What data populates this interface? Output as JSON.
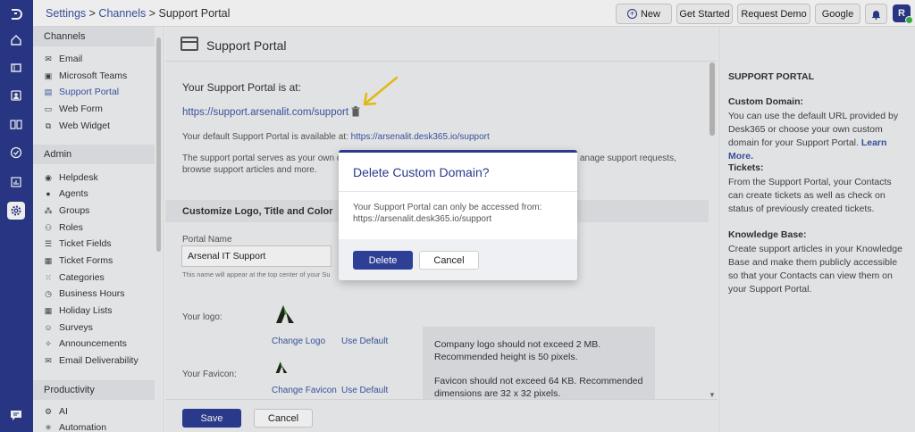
{
  "breadcrumb": {
    "settings": "Settings",
    "sep1": " > ",
    "channels": "Channels",
    "sep2": " > ",
    "current": "Support Portal"
  },
  "topbar": {
    "new_label": "New",
    "get_started_label": "Get Started",
    "request_demo_label": "Request Demo",
    "google_label": "Google",
    "avatar_initial": "R"
  },
  "rail_icons": [
    "logo-icon",
    "home-icon",
    "ticket-icon",
    "contacts-icon",
    "knowledge-base-icon",
    "tasks-icon",
    "reports-icon",
    "settings-icon",
    "chat-icon"
  ],
  "sidebar": {
    "channels_title": "Channels",
    "channels": [
      {
        "label": "Email",
        "icon": "email-icon"
      },
      {
        "label": "Microsoft Teams",
        "icon": "teams-icon"
      },
      {
        "label": "Support Portal",
        "icon": "portal-icon",
        "selected": true
      },
      {
        "label": "Web Form",
        "icon": "form-icon"
      },
      {
        "label": "Web Widget",
        "icon": "widget-icon"
      }
    ],
    "admin_title": "Admin",
    "admin": [
      {
        "label": "Helpdesk",
        "icon": "helpdesk-icon"
      },
      {
        "label": "Agents",
        "icon": "agent-icon"
      },
      {
        "label": "Groups",
        "icon": "groups-icon"
      },
      {
        "label": "Roles",
        "icon": "roles-icon"
      },
      {
        "label": "Ticket Fields",
        "icon": "fields-icon"
      },
      {
        "label": "Ticket Forms",
        "icon": "forms-icon"
      },
      {
        "label": "Categories",
        "icon": "categories-icon"
      },
      {
        "label": "Business Hours",
        "icon": "clock-icon"
      },
      {
        "label": "Holiday Lists",
        "icon": "calendar-icon"
      },
      {
        "label": "Surveys",
        "icon": "survey-icon"
      },
      {
        "label": "Announcements",
        "icon": "megaphone-icon"
      },
      {
        "label": "Email Deliverability",
        "icon": "mail-check-icon"
      }
    ],
    "productivity_title": "Productivity",
    "productivity": [
      {
        "label": "AI",
        "icon": "ai-gear-icon"
      },
      {
        "label": "Automation",
        "icon": "automation-icon"
      }
    ]
  },
  "main": {
    "title": "Support Portal",
    "portal_at_label": "Your Support Portal is at:",
    "portal_url": "https://support.arsenalit.com/support",
    "default_portal_text": "Your default Support Portal is available at:",
    "default_portal_url": "https://arsenalit.desk365.io/support",
    "desc_line1_left": "The support portal serves as your own out",
    "desc_line1_right": "anage support requests,",
    "desc_line2": "browse support articles and more.",
    "customize_title": "Customize Logo, Title and Color",
    "portal_name_label": "Portal Name",
    "portal_name_value": "Arsenal IT Support",
    "portal_name_hint": "This name will appear at the top center of your Su",
    "logo_label": "Your logo:",
    "change_logo": "Change Logo",
    "use_default_logo": "Use Default",
    "favicon_label": "Your Favicon:",
    "change_favicon": "Change Favicon",
    "use_default_favicon": "Use Default",
    "info_logo": "Company logo should not exceed 2 MB. Recommended height is 50 pixels.",
    "info_favicon": "Favicon should not exceed 64 KB. Recommended dimensions are 32 x 32 pixels.",
    "save_label": "Save",
    "cancel_label": "Cancel"
  },
  "help": {
    "title": "SUPPORT PORTAL",
    "custom_domain_title": "Custom Domain:",
    "custom_domain_text": "You can use the default URL provided by Desk365 or choose your own custom domain for your Support Portal.",
    "learn_more": "Learn More.",
    "tickets_title": "Tickets:",
    "tickets_text": "From the Support Portal, your Contacts can create tickets as well as check on status of previously created tickets.",
    "kb_title": "Knowledge Base:",
    "kb_text": "Create support articles in your Knowledge Base and make them publicly accessible so that your Contacts can view them on your Support Portal."
  },
  "modal": {
    "title": "Delete Custom Domain?",
    "body_line1": "Your Support Portal can only be accessed from:",
    "body_line2": "https://arsenalit.desk365.io/support",
    "delete_label": "Delete",
    "cancel_label": "Cancel"
  },
  "colors": {
    "brand": "#2b3a8c",
    "link": "#3b57a6",
    "annotation_arrow": "#f5c518"
  }
}
